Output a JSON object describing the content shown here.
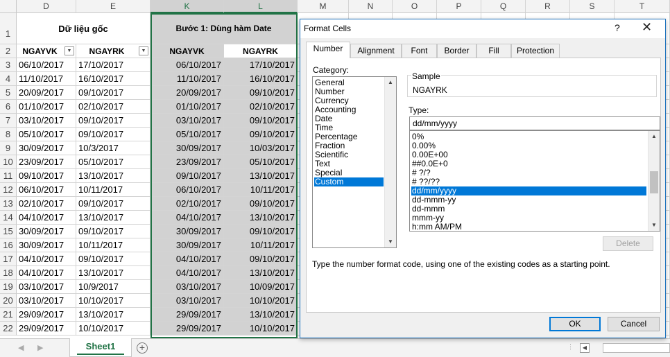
{
  "sheet": {
    "columns": [
      {
        "label": "D",
        "selected": false
      },
      {
        "label": "E",
        "selected": false
      },
      {
        "label": "K",
        "selected": true
      },
      {
        "label": "L",
        "selected": true
      },
      {
        "label": "M",
        "selected": false
      },
      {
        "label": "N",
        "selected": false
      },
      {
        "label": "O",
        "selected": false
      },
      {
        "label": "P",
        "selected": false
      },
      {
        "label": "Q",
        "selected": false
      },
      {
        "label": "R",
        "selected": false
      },
      {
        "label": "S",
        "selected": false
      },
      {
        "label": "T",
        "selected": false
      }
    ],
    "row_numbers": [
      "1",
      "2",
      "3",
      "4",
      "5",
      "6",
      "7",
      "8",
      "9",
      "10",
      "11",
      "12",
      "13",
      "14",
      "15",
      "16",
      "17",
      "18",
      "19",
      "20",
      "21",
      "22"
    ],
    "header_raw": "Dữ liệu gốc",
    "header_step1": "Bước 1: Dùng hàm Date",
    "col_headers": [
      "NGAYVK",
      "NGAYRK",
      "NGAYVK",
      "NGAYRK"
    ],
    "filter_icon": "dropdown-arrow-icon",
    "rows": [
      [
        "06/10/2017",
        "17/10/2017",
        "06/10/2017",
        "17/10/2017"
      ],
      [
        "11/10/2017",
        "16/10/2017",
        "11/10/2017",
        "16/10/2017"
      ],
      [
        "20/09/2017",
        "09/10/2017",
        "20/09/2017",
        "09/10/2017"
      ],
      [
        "01/10/2017",
        "02/10/2017",
        "01/10/2017",
        "02/10/2017"
      ],
      [
        "03/10/2017",
        "09/10/2017",
        "03/10/2017",
        "09/10/2017"
      ],
      [
        "05/10/2017",
        "09/10/2017",
        "05/10/2017",
        "09/10/2017"
      ],
      [
        "30/09/2017",
        "10/3/2017",
        "30/09/2017",
        "10/03/2017"
      ],
      [
        "23/09/2017",
        "05/10/2017",
        "23/09/2017",
        "05/10/2017"
      ],
      [
        "09/10/2017",
        "13/10/2017",
        "09/10/2017",
        "13/10/2017"
      ],
      [
        "06/10/2017",
        "10/11/2017",
        "06/10/2017",
        "10/11/2017"
      ],
      [
        "02/10/2017",
        "09/10/2017",
        "02/10/2017",
        "09/10/2017"
      ],
      [
        "04/10/2017",
        "13/10/2017",
        "04/10/2017",
        "13/10/2017"
      ],
      [
        "30/09/2017",
        "09/10/2017",
        "30/09/2017",
        "09/10/2017"
      ],
      [
        "30/09/2017",
        "10/11/2017",
        "30/09/2017",
        "10/11/2017"
      ],
      [
        "04/10/2017",
        "09/10/2017",
        "04/10/2017",
        "09/10/2017"
      ],
      [
        "04/10/2017",
        "13/10/2017",
        "04/10/2017",
        "13/10/2017"
      ],
      [
        "03/10/2017",
        "10/9/2017",
        "03/10/2017",
        "10/09/2017"
      ],
      [
        "03/10/2017",
        "10/10/2017",
        "03/10/2017",
        "10/10/2017"
      ],
      [
        "29/09/2017",
        "13/10/2017",
        "29/09/2017",
        "13/10/2017"
      ],
      [
        "29/09/2017",
        "10/10/2017",
        "29/09/2017",
        "10/10/2017"
      ]
    ],
    "sheet_tab": "Sheet1",
    "add_sheet": "+",
    "icons": {
      "nav_prev": "triangle-left-icon",
      "nav_next": "triangle-right-icon",
      "add_sheet": "plus-circle-icon",
      "scroll_left": "triangle-left-icon"
    }
  },
  "dialog": {
    "title": "Format Cells",
    "help": "?",
    "close": "✕",
    "tabs": [
      "Number",
      "Alignment",
      "Font",
      "Border",
      "Fill",
      "Protection"
    ],
    "active_tab": "Number",
    "category_label": "Category:",
    "categories": [
      "General",
      "Number",
      "Currency",
      "Accounting",
      "Date",
      "Time",
      "Percentage",
      "Fraction",
      "Scientific",
      "Text",
      "Special",
      "Custom"
    ],
    "selected_category": "Custom",
    "sample_label": "Sample",
    "sample_value": "NGAYRK",
    "type_label": "Type:",
    "type_value": "dd/mm/yyyy",
    "type_list": [
      "0%",
      "0.00%",
      "0.00E+00",
      "##0.0E+0",
      "# ?/?",
      "# ??/??",
      "dd/mm/yyyy",
      "dd-mmm-yy",
      "dd-mmm",
      "mmm-yy",
      "h:mm AM/PM"
    ],
    "selected_type": "dd/mm/yyyy",
    "delete_button": "Delete",
    "hint": "Type the number format code, using one of the existing codes as a starting point.",
    "ok_button": "OK",
    "cancel_button": "Cancel",
    "colors": {
      "accent": "#0078d7",
      "excel_green": "#217346",
      "selection_gray": "#d2d2d2"
    }
  }
}
